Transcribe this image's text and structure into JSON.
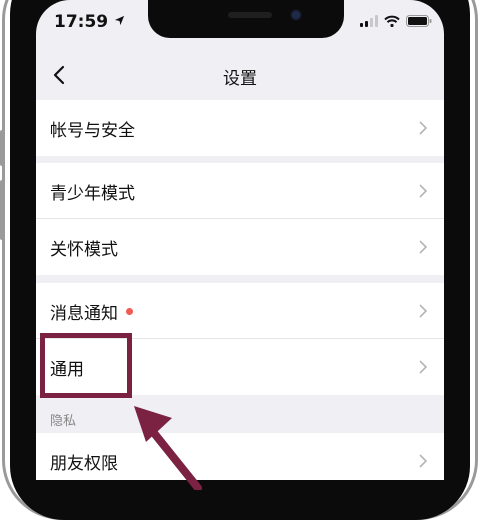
{
  "status_bar": {
    "time": "17:59"
  },
  "nav": {
    "title": "设置"
  },
  "settings": {
    "account_security": "帐号与安全",
    "teen_mode": "青少年模式",
    "care_mode": "关怀模式",
    "notifications": "消息通知",
    "general": "通用",
    "privacy_section": "隐私",
    "friend_permissions": "朋友权限"
  },
  "colors": {
    "highlight": "#7b2142",
    "notification_dot": "#f25a52",
    "background": "#efeff4"
  }
}
